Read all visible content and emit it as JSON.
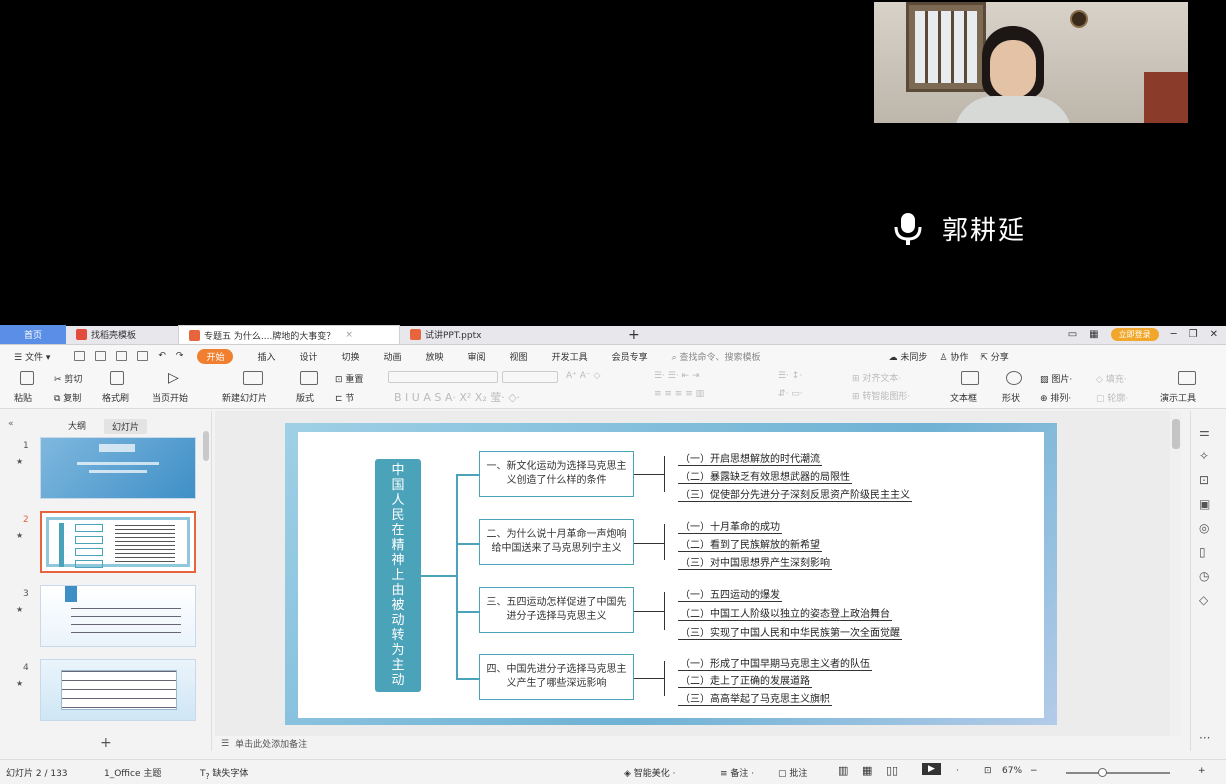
{
  "speaker": {
    "name": "郭耕延"
  },
  "tabs": {
    "home": "首页",
    "template": "找稻壳模板",
    "doc1": "专题五 为什么....牌地的大事变？",
    "doc2": "试讲PPT.pptx",
    "add": "+",
    "login": "立即登录"
  },
  "menu": {
    "file": "文件",
    "items": [
      "开始",
      "插入",
      "设计",
      "切换",
      "动画",
      "放映",
      "审阅",
      "视图",
      "开发工具",
      "会员专享"
    ],
    "search": "查找命令、搜索模板",
    "sync": "未同步",
    "collab": "协作",
    "share": "分享"
  },
  "ribbon": {
    "paste": "粘贴",
    "cut": "剪切",
    "copy": "复制",
    "format_painter": "格式刷",
    "from_start": "当页开始",
    "new_slide": "新建幻灯片",
    "layout": "版式",
    "reset": "重置",
    "section": "节",
    "align_text": "对齐文本",
    "convert_smartart": "转智能图形",
    "textbox": "文本框",
    "shape": "形状",
    "picture": "图片",
    "arrange": "排列",
    "fill": "填充",
    "outline": "轮廓",
    "present_tools": "演示工具"
  },
  "panel": {
    "outline_tab": "大纲",
    "slides_tab": "幻灯片",
    "slide_numbers": [
      "1",
      "2",
      "3",
      "4"
    ],
    "add_slide": "+"
  },
  "slide": {
    "vertical_title": "中国人民在精神上由被动转为主动",
    "sections": [
      {
        "box": "一、新文化运动为选择马克思主义创造了什么样的条件",
        "items": [
          "（一）开启思想解放的时代潮流",
          "（二）暴露缺乏有效思想武器的局限性",
          "（三）促使部分先进分子深刻反思资产阶级民主主义"
        ]
      },
      {
        "box": "二、为什么说十月革命一声炮响给中国送来了马克思列宁主义",
        "items": [
          "（一）十月革命的成功",
          "（二）看到了民族解放的新希望",
          "（三）对中国思想界产生深刻影响"
        ]
      },
      {
        "box": "三、五四运动怎样促进了中国先进分子选择马克思主义",
        "items": [
          "（一）五四运动的爆发",
          "（二）中国工人阶级以独立的姿态登上政治舞台",
          "（三）实现了中国人民和中华民族第一次全面觉醒"
        ]
      },
      {
        "box": "四、中国先进分子选择马克思主义产生了哪些深远影响",
        "items": [
          "（一）形成了中国早期马克思主义者的队伍",
          "（二）走上了正确的发展道路",
          "（三）高高举起了马克思主义旗帜"
        ]
      }
    ]
  },
  "notes": {
    "placeholder": "单击此处添加备注"
  },
  "status": {
    "slide": "幻灯片 2 / 133",
    "theme": "1_Office 主题",
    "missing_font": "缺失字体",
    "beautify": "智能美化",
    "notes": "备注",
    "comment": "批注",
    "zoom": "67%"
  },
  "colors": {
    "accent": "#4aa3b8",
    "tab_blue": "#5b8ee6",
    "active_menu": "#f08030"
  }
}
